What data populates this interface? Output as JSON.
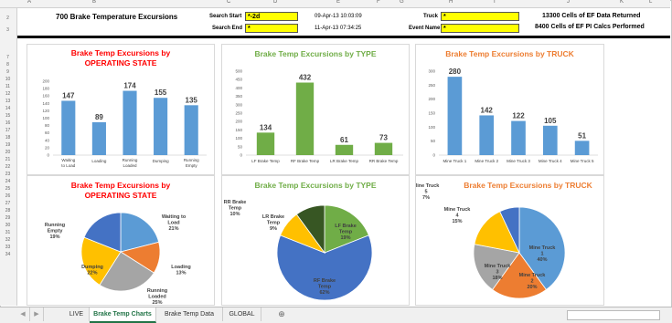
{
  "spreadsheet": {
    "columns": [
      "A",
      "B",
      "C",
      "D",
      "E",
      "F",
      "G",
      "H",
      "I",
      "J",
      "K",
      "L"
    ],
    "rows": [
      "2",
      "3",
      "7",
      "8",
      "9",
      "10",
      "11",
      "12",
      "13",
      "14",
      "15",
      "16",
      "17",
      "18",
      "19",
      "20",
      "21",
      "22",
      "23",
      "24",
      "25",
      "26",
      "27",
      "28",
      "29",
      "30",
      "31",
      "32",
      "33",
      "34"
    ],
    "title": "700 Brake Temperature Excursions",
    "search_start_label": "Search Start",
    "search_start_value": "*-2d",
    "search_end_label": "Search End",
    "search_end_value": "*",
    "start_time": "09-Apr-13 10:03:09",
    "end_time": "11-Apr-13 07:34:25",
    "truck_label": "Truck",
    "truck_value": "*",
    "event_name_label": "Event Name",
    "event_name_value": "*",
    "cells_returned": "13300 Cells of EF Data Returned",
    "cells_calcs": "8400 Cells of EF PI Calcs Performed"
  },
  "colors": {
    "blue": "#5b9bd5",
    "green": "#70ad47",
    "red": "#ff0000",
    "orange": "#ed7d31",
    "grey": "#a5a5a5",
    "yellow": "#ffc000",
    "darkblue": "#4472c4",
    "darkgreen": "#375623"
  },
  "chart_data": [
    {
      "type": "bar",
      "title": "Brake Temp Excursions by OPERATING STATE",
      "categories": [
        "Waiting to Load",
        "Loading",
        "Running Loaded",
        "Dumping",
        "Running Empty"
      ],
      "values": [
        147,
        89,
        174,
        155,
        135
      ],
      "ylim": [
        0,
        200
      ],
      "yticks": [
        "200",
        "180",
        "160",
        "140",
        "120",
        "100",
        "80",
        "60",
        "40",
        "20",
        "0"
      ],
      "color": "#5b9bd5"
    },
    {
      "type": "bar",
      "title": "Brake Temp Excursions by TYPE",
      "categories": [
        "LF Brake Temp",
        "RF Brake Temp",
        "LR Brake Temp",
        "RR Brake Temp"
      ],
      "values": [
        134,
        432,
        61,
        73
      ],
      "ylim": [
        0,
        500
      ],
      "yticks": [
        "500",
        "450",
        "400",
        "350",
        "300",
        "250",
        "200",
        "150",
        "100",
        "50",
        "0"
      ],
      "color": "#70ad47"
    },
    {
      "type": "bar",
      "title": "Brake Temp Excursions by TRUCK",
      "categories": [
        "Mine Truck 1",
        "Mine Truck 2",
        "Mine Truck 3",
        "Mine Truck 4",
        "Mine Truck 5"
      ],
      "values": [
        280,
        142,
        122,
        105,
        51
      ],
      "ylim": [
        0,
        300
      ],
      "yticks": [
        "300",
        "250",
        "200",
        "150",
        "100",
        "50",
        "0"
      ],
      "color": "#5b9bd5"
    },
    {
      "type": "pie",
      "title": "Brake Temp Excursions by OPERATING STATE",
      "slices": [
        {
          "label": "Waiting to Load",
          "pct": "21%",
          "value": 21,
          "color": "#5b9bd5"
        },
        {
          "label": "Loading",
          "pct": "13%",
          "value": 13,
          "color": "#ed7d31"
        },
        {
          "label": "Running Loaded",
          "pct": "25%",
          "value": 25,
          "color": "#a5a5a5"
        },
        {
          "label": "Dumping",
          "pct": "22%",
          "value": 22,
          "color": "#ffc000"
        },
        {
          "label": "Running Empty",
          "pct": "19%",
          "value": 19,
          "color": "#4472c4"
        }
      ]
    },
    {
      "type": "pie",
      "title": "Brake Temp Excursions by TYPE",
      "slices": [
        {
          "label": "LF Brake Temp",
          "pct": "19%",
          "value": 19,
          "color": "#70ad47"
        },
        {
          "label": "RF Brake Temp",
          "pct": "62%",
          "value": 62,
          "color": "#4472c4"
        },
        {
          "label": "LR Brake Temp",
          "pct": "9%",
          "value": 9,
          "color": "#ffc000"
        },
        {
          "label": "RR Brake Temp",
          "pct": "10%",
          "value": 10,
          "color": "#375623"
        }
      ]
    },
    {
      "type": "pie",
      "title": "Brake Temp Excursions by TRUCK",
      "slices": [
        {
          "label": "Mine Truck 1",
          "pct": "40%",
          "value": 40,
          "color": "#5b9bd5"
        },
        {
          "label": "Mine Truck 2",
          "pct": "20%",
          "value": 20,
          "color": "#ed7d31"
        },
        {
          "label": "Mine Truck 3",
          "pct": "18%",
          "value": 18,
          "color": "#a5a5a5"
        },
        {
          "label": "Mine Truck 4",
          "pct": "15%",
          "value": 15,
          "color": "#ffc000"
        },
        {
          "label": "Mine Truck 5",
          "pct": "7%",
          "value": 7,
          "color": "#4472c4"
        }
      ]
    }
  ],
  "tabs": [
    "LIVE",
    "Brake Temp Charts",
    "Brake Temp Data",
    "GLOBAL"
  ],
  "active_tab": "Brake Temp Charts",
  "icons": {
    "add_sheet": "plus-circle-icon",
    "nav_prev": "chevron-left-icon",
    "nav_next": "chevron-right-icon"
  }
}
